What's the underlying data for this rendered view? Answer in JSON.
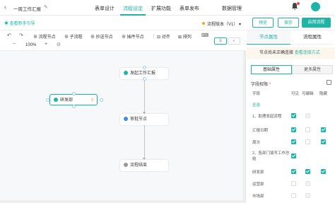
{
  "app": {
    "title": "一周工作汇报",
    "tabs": [
      "表单设计",
      "流程设定",
      "扩展功能",
      "表单发布",
      "数据管理"
    ],
    "active_tab": 1
  },
  "subbar": {
    "guide_link": "查看新手引导",
    "version": "流程版本（V1）",
    "preview_label": "预览",
    "save_label": "保存",
    "enable_label": "启用流程"
  },
  "toolbar": {
    "flow_node": "流程节点",
    "sub_flow": "子流程",
    "cc_node": "抄送节点",
    "insert_node": "插件节点",
    "align": "对齐",
    "arrange": "排列",
    "zoom": "100%"
  },
  "nodes": {
    "start": "发起工作汇报",
    "dept": "研发部",
    "review": "审批节点",
    "end": "流程结束"
  },
  "panel": {
    "tabs": [
      "节点属性",
      "流程属性"
    ],
    "warning": "节点尚未正确连接",
    "warning_link": "查看连接方式",
    "subtabs": [
      "基础属性",
      "更多属性"
    ],
    "section_title": "字段权限",
    "headers": [
      "字段",
      "可见",
      "可编辑",
      "隐藏"
    ],
    "rows": [
      {
        "label": "全选",
        "link": true
      },
      {
        "label": "1、助理发起流程"
      },
      {
        "label": "汇报日期"
      },
      {
        "label": "周次"
      },
      {
        "label": "2、各部门填写工作总结"
      },
      {
        "label": "研发部"
      },
      {
        "label": "运营部"
      },
      {
        "label": "市场部"
      }
    ]
  },
  "colors": {
    "accent": "#1fb5a6",
    "warning_bg": "#fdf6ec",
    "badge": "#f04b4b"
  }
}
